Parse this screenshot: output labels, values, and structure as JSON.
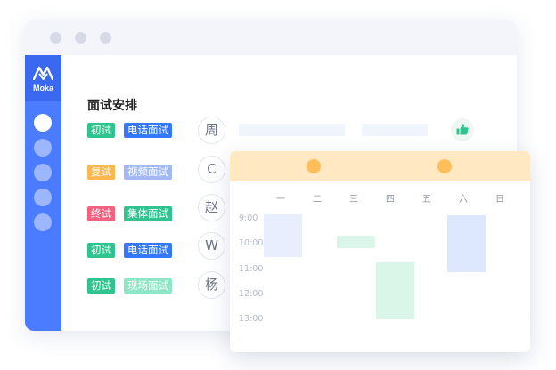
{
  "brand": {
    "name": "Moka"
  },
  "schedule": {
    "title": "面试安排",
    "rows": [
      {
        "stage": "初试",
        "type": "电话面试",
        "avatar": "周"
      },
      {
        "stage": "复试",
        "type": "视频面试",
        "avatar": "C"
      },
      {
        "stage": "终试",
        "type": "集体面试",
        "avatar": "赵"
      },
      {
        "stage": "初试",
        "type": "电话面试",
        "avatar": "W"
      },
      {
        "stage": "初试",
        "type": "现场面试",
        "avatar": "杨"
      }
    ]
  },
  "calendar": {
    "weekdays": [
      "一",
      "二",
      "三",
      "四",
      "五",
      "六",
      "日"
    ],
    "times": [
      "9:00",
      "10:00",
      "11:00",
      "12:00",
      "13:00"
    ]
  },
  "colors": {
    "brand_blue": "#4b7bff",
    "tag_green": "#2fc48d",
    "tag_blue": "#3478ff",
    "tag_orange": "#ffb64d",
    "tag_lilac": "#a3b8f9",
    "tag_red": "#f5617f",
    "tag_mint": "#8ee6c7",
    "accent_yellow": "#ffbe5a"
  },
  "icons": {
    "thumb": "thumbs-up-icon"
  }
}
